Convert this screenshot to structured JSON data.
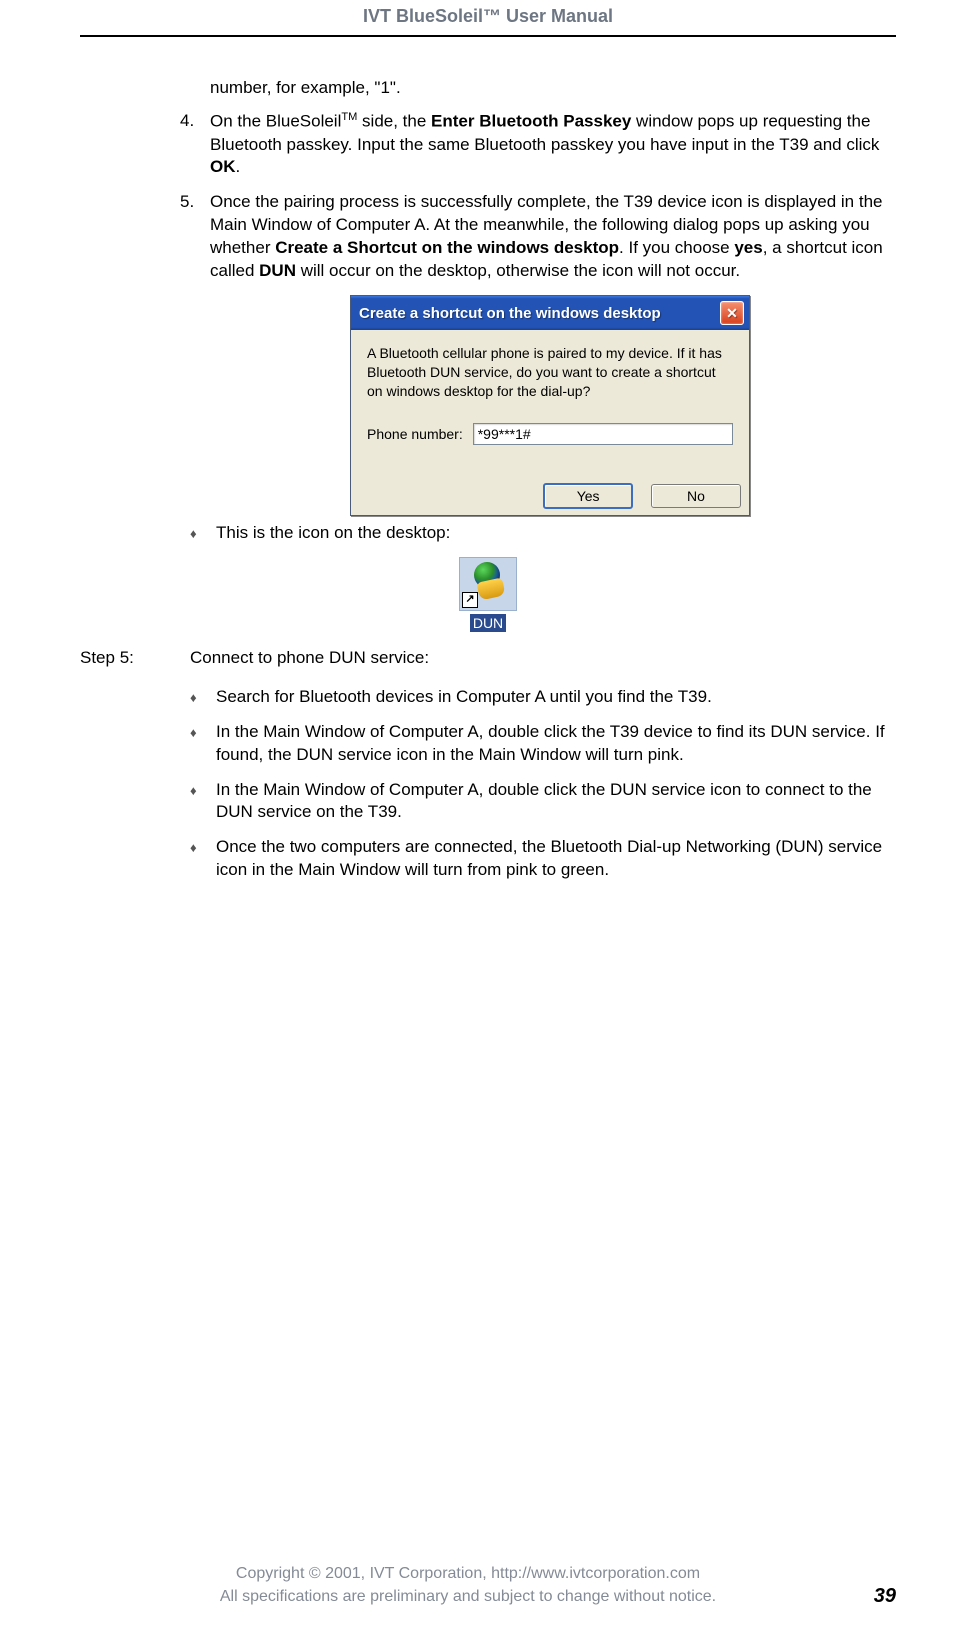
{
  "header": {
    "title": "IVT BlueSoleil™ User Manual"
  },
  "fragment_line": "number, for example, \"1\".",
  "steps": [
    {
      "num": "4.",
      "pre": "On the BlueSoleil",
      "tm": "TM",
      "mid1": " side, the ",
      "bold1": "Enter Bluetooth Passkey",
      "mid2": " window pops up requesting the Bluetooth passkey. Input the same Bluetooth passkey you have input in the T39 and click ",
      "bold2": "OK",
      "tail": "."
    },
    {
      "num": "5.",
      "pre": "Once the pairing process is successfully complete, the T39 device icon is displayed in the Main Window of Computer A. At the meanwhile, the following dialog pops up asking you whether ",
      "bold1": "Create a Shortcut on the windows desktop",
      "mid1": ". If you choose ",
      "bold2": "yes",
      "mid2": ", a shortcut icon called ",
      "bold3": "DUN",
      "tail": " will occur on the desktop, otherwise the icon will not occur."
    }
  ],
  "dialog": {
    "title": "Create a shortcut on the windows desktop",
    "message": "A Bluetooth cellular phone is paired to my device.  If it has Bluetooth DUN service, do you want to create a shortcut on windows desktop for the dial-up?",
    "phone_label": "Phone number:",
    "phone_value": "*99***1#",
    "yes": "Yes",
    "no": "No"
  },
  "icon_note": "This is the icon on the desktop:",
  "dun_icon_label": "DUN",
  "step5": {
    "label": "Step 5:",
    "title": "Connect to phone DUN service:",
    "bullets": [
      "Search for Bluetooth devices in Computer A until you find the T39.",
      "In the Main Window of Computer A, double click the T39 device to find its DUN service. If found, the DUN service icon in the Main Window will turn pink.",
      "In the Main Window of Computer A, double click the DUN service icon to connect to the DUN service on the T39.",
      "Once the two computers are connected, the Bluetooth Dial-up Networking (DUN) service icon in the Main Window will turn from pink to green."
    ]
  },
  "footer": {
    "line1": "Copyright © 2001, IVT Corporation, http://www.ivtcorporation.com",
    "line2": "All specifications are preliminary and subject to change without notice.",
    "page": "39"
  }
}
